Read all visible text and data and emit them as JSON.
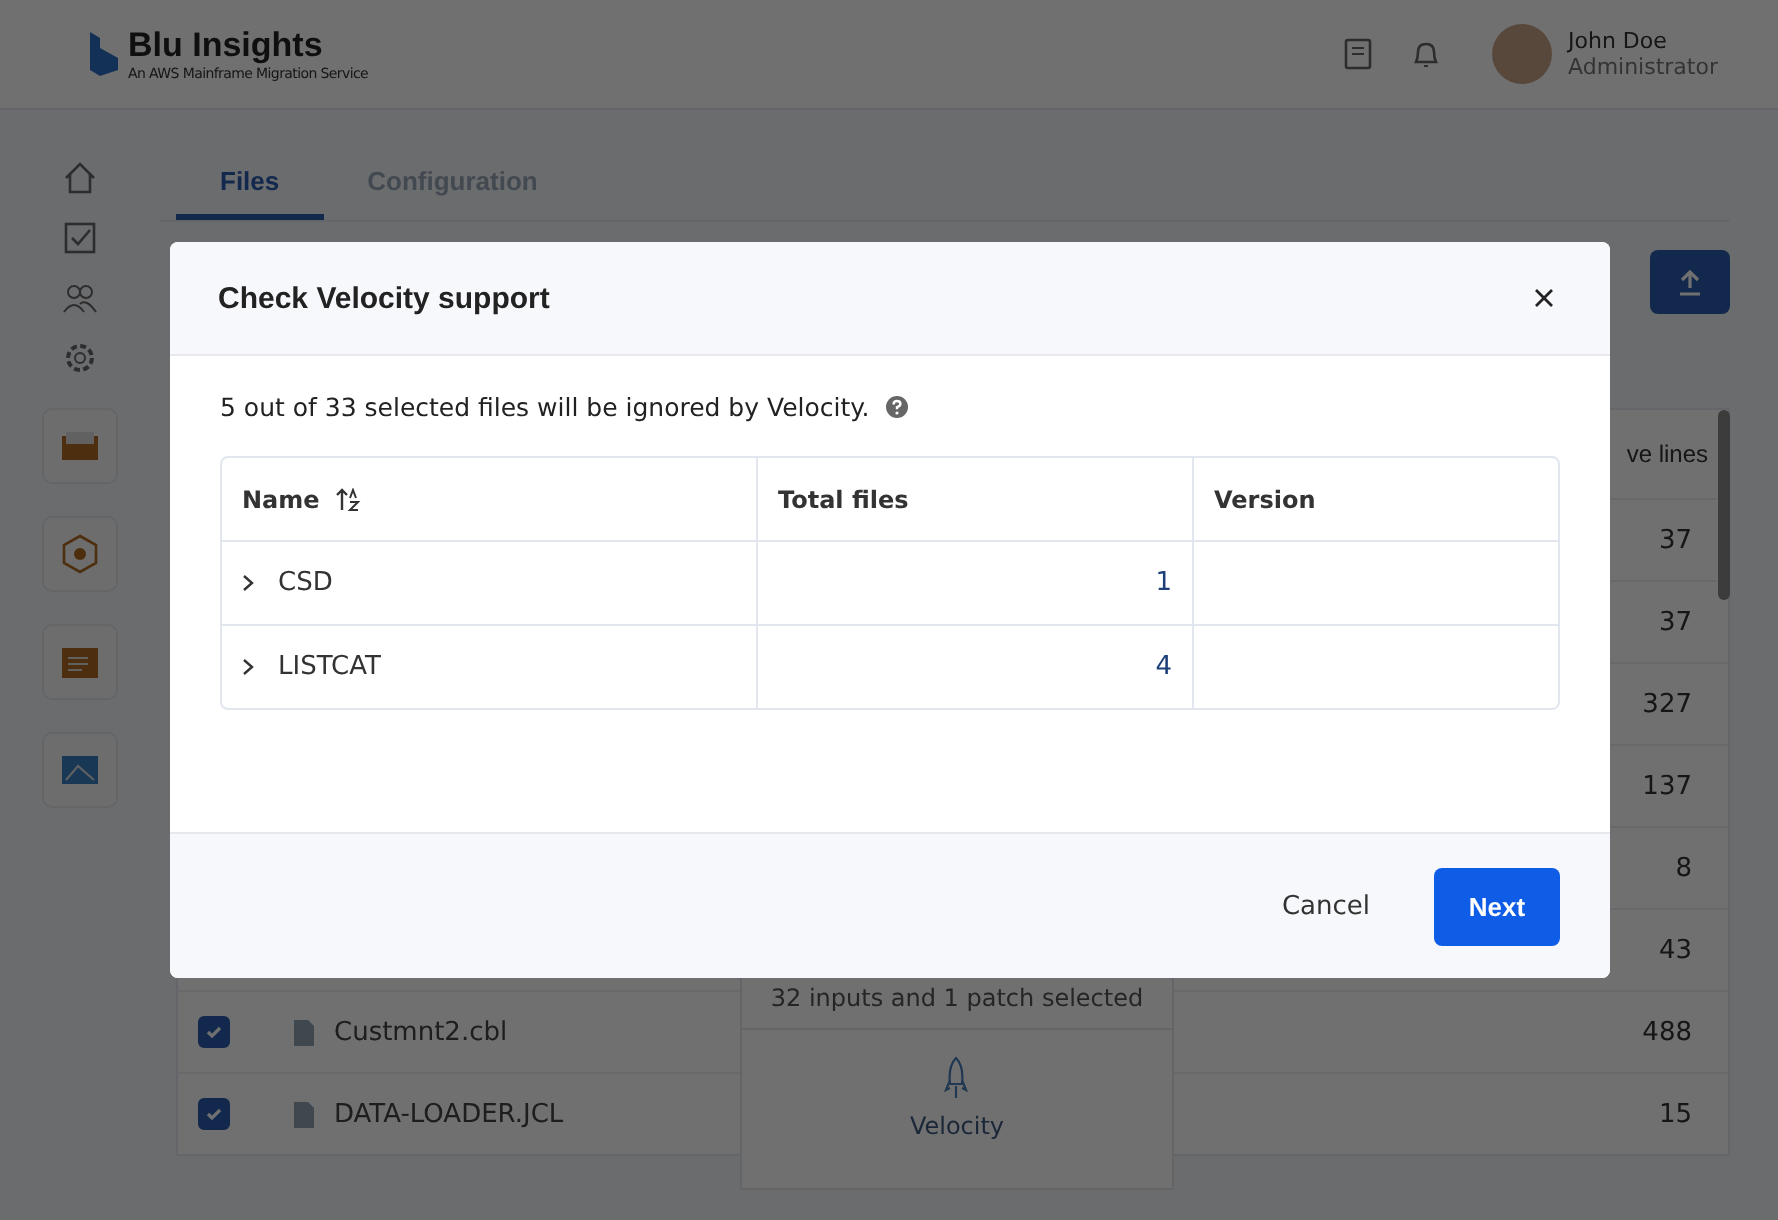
{
  "header": {
    "brand": "Blu Insights",
    "tagline": "An AWS Mainframe Migration Service",
    "user": {
      "name": "John Doe",
      "role": "Administrator"
    }
  },
  "tabs": [
    {
      "label": "Files",
      "selected": true
    },
    {
      "label": "Configuration",
      "selected": false
    }
  ],
  "files_table": {
    "column_header": "ve lines",
    "rows": [
      {
        "lines": "37"
      },
      {
        "lines": "37"
      },
      {
        "lines": "327"
      },
      {
        "lines": "137"
      },
      {
        "lines": "8"
      },
      {
        "lines": "43"
      },
      {
        "checked": true,
        "name": "Custmnt2.cbl",
        "lines": "488"
      },
      {
        "checked": true,
        "name": "DATA-LOADER.JCL",
        "lines": "15"
      }
    ]
  },
  "selection_panel": {
    "summary": "32 inputs and 1 patch selected",
    "action": "Velocity"
  },
  "dialog": {
    "title": "Check Velocity support",
    "message": "5 out of 33 selected files will be ignored by Velocity.",
    "columns": [
      "Name",
      "Total files",
      "Version"
    ],
    "rows": [
      {
        "name": "CSD",
        "total_files": "1",
        "expanded": false
      },
      {
        "name": "LISTCAT",
        "total_files": "4",
        "expanded": false
      }
    ],
    "buttons": {
      "cancel": "Cancel",
      "next": "Next"
    }
  }
}
